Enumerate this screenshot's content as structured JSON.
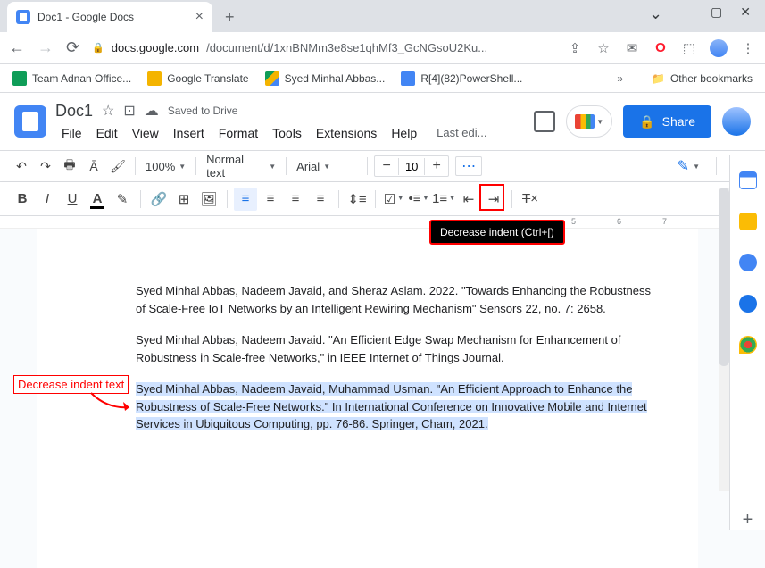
{
  "browser": {
    "tab_title": "Doc1 - Google Docs",
    "url_domain": "docs.google.com",
    "url_path": "/document/d/1xnBNMm3e8se1qhMf3_GcNGsoU2Ku..."
  },
  "bookmarks": {
    "items": [
      {
        "label": "Team Adnan Office..."
      },
      {
        "label": "Google Translate"
      },
      {
        "label": "Syed Minhal Abbas..."
      },
      {
        "label": "R[4](82)PowerShell..."
      }
    ],
    "other": "Other bookmarks"
  },
  "docs": {
    "title": "Doc1",
    "saved": "Saved to Drive",
    "menus": [
      "File",
      "Edit",
      "View",
      "Insert",
      "Format",
      "Tools",
      "Extensions",
      "Help"
    ],
    "last_edit": "Last edi...",
    "share": "Share"
  },
  "toolbar": {
    "zoom": "100%",
    "style": "Normal text",
    "font": "Arial",
    "font_size": "10"
  },
  "tooltip": "Decrease indent (Ctrl+[)",
  "annotation": "Decrease indent text",
  "ruler_marks": [
    "5",
    "6",
    "7"
  ],
  "doc": {
    "p1": "Syed Minhal Abbas, Nadeem Javaid, and Sheraz Aslam. 2022. \"Towards Enhancing the Robustness of Scale-Free IoT Networks by an Intelligent Rewiring Mechanism\" Sensors 22, no. 7: 2658.",
    "p2": "Syed Minhal Abbas, Nadeem Javaid. \"An Efficient Edge Swap Mechanism for Enhancement of Robustness in Scale-free Networks,\" in IEEE Internet of Things Journal.",
    "p3": "Syed Minhal Abbas, Nadeem Javaid, Muhammad Usman. \"An Efficient Approach to Enhance the Robustness of Scale-Free Networks.\" In International Conference on Innovative Mobile and Internet Services in Ubiquitous Computing, pp. 76-86. Springer, Cham, 2021."
  }
}
